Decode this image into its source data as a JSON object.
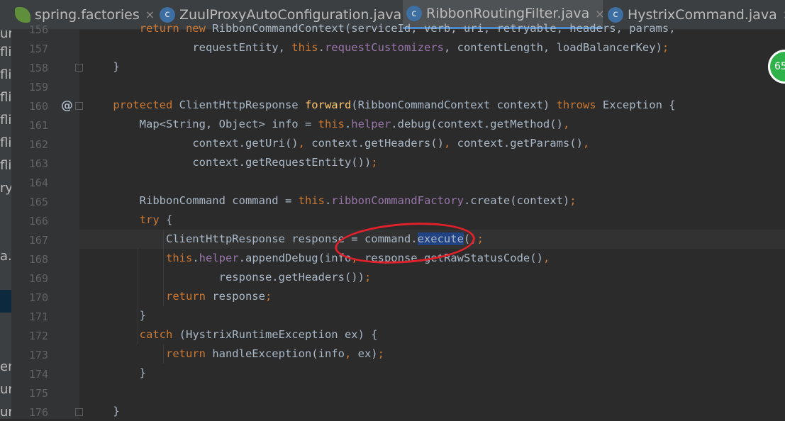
{
  "tabs": [
    {
      "label": "spring.factories",
      "icon": "leaf-icon",
      "active": false
    },
    {
      "label": "ZuulProxyAutoConfiguration.java",
      "icon": "class-icon",
      "active": false
    },
    {
      "label": "RibbonRoutingFilter.java",
      "icon": "class-icon",
      "active": true
    },
    {
      "label": "HystrixCommand.java",
      "icon": "class-icon",
      "active": false
    }
  ],
  "tab_close_glyph": "×",
  "class_icon_letter": "c",
  "sidebar_fragments": [
    "ur",
    "fli",
    "fli",
    "fli",
    "fli",
    "fli",
    "fli",
    "ry",
    "a.j",
    "en",
    "ur",
    "ur"
  ],
  "line_numbers": [
    "156",
    "157",
    "158",
    "159",
    "160",
    "161",
    "162",
    "163",
    "164",
    "165",
    "166",
    "167",
    "168",
    "169",
    "170",
    "171",
    "172",
    "173",
    "174",
    "175",
    "176"
  ],
  "override_marker": "@",
  "code_lines": [
    {
      "indent": "        ",
      "parts": [
        {
          "t": "return new ",
          "c": "kw"
        },
        {
          "t": "RibbonCommandContext(serviceId, verb, uri, retryable, headers, params,"
        }
      ]
    },
    {
      "indent": "                ",
      "parts": [
        {
          "t": "requestEntity, "
        },
        {
          "t": "this",
          "c": "kw"
        },
        {
          "t": "."
        },
        {
          "t": "requestCustomizers",
          "c": "fld"
        },
        {
          "t": ", contentLength, loadBalancerKey)"
        },
        {
          "t": ";",
          "c": "kw"
        }
      ]
    },
    {
      "indent": "    ",
      "parts": [
        {
          "t": "}"
        }
      ]
    },
    {
      "indent": "",
      "parts": []
    },
    {
      "indent": "    ",
      "parts": [
        {
          "t": "protected ",
          "c": "kw"
        },
        {
          "t": "ClientHttpResponse "
        },
        {
          "t": "forward",
          "c": "fn"
        },
        {
          "t": "(RibbonCommandContext context) "
        },
        {
          "t": "throws ",
          "c": "kw"
        },
        {
          "t": "Exception {"
        }
      ]
    },
    {
      "indent": "        ",
      "parts": [
        {
          "t": "Map<String, Object> info = "
        },
        {
          "t": "this",
          "c": "kw"
        },
        {
          "t": "."
        },
        {
          "t": "helper",
          "c": "fld"
        },
        {
          "t": ".debug(context.getMethod()"
        },
        {
          "t": ",",
          "c": "kw"
        }
      ]
    },
    {
      "indent": "                ",
      "parts": [
        {
          "t": "context.getUri()"
        },
        {
          "t": ", ",
          "c": "kw"
        },
        {
          "t": "context.getHeaders()"
        },
        {
          "t": ", ",
          "c": "kw"
        },
        {
          "t": "context.getParams()"
        },
        {
          "t": ",",
          "c": "kw"
        }
      ]
    },
    {
      "indent": "                ",
      "parts": [
        {
          "t": "context.getRequestEntity())"
        },
        {
          "t": ";",
          "c": "kw"
        }
      ]
    },
    {
      "indent": "",
      "parts": []
    },
    {
      "indent": "        ",
      "parts": [
        {
          "t": "RibbonCommand command = "
        },
        {
          "t": "this",
          "c": "kw"
        },
        {
          "t": "."
        },
        {
          "t": "ribbonCommandFactory",
          "c": "fld"
        },
        {
          "t": ".create(context)"
        },
        {
          "t": ";",
          "c": "kw"
        }
      ]
    },
    {
      "indent": "        ",
      "parts": [
        {
          "t": "try ",
          "c": "kw"
        },
        {
          "t": "{"
        }
      ]
    },
    {
      "indent": "            ",
      "parts": [
        {
          "t": "ClientHttpResponse response = command."
        },
        {
          "t": "execute",
          "c": "sel"
        },
        {
          "t": "()"
        },
        {
          "t": ";",
          "c": "kw"
        }
      ]
    },
    {
      "indent": "            ",
      "parts": [
        {
          "t": "this",
          "c": "kw"
        },
        {
          "t": "."
        },
        {
          "t": "helper",
          "c": "fld"
        },
        {
          "t": ".appendDebug(info"
        },
        {
          "t": ", ",
          "c": "kw"
        },
        {
          "t": "response.getRawStatusCode()"
        },
        {
          "t": ",",
          "c": "kw"
        }
      ]
    },
    {
      "indent": "                    ",
      "parts": [
        {
          "t": "response.getHeaders())"
        },
        {
          "t": ";",
          "c": "kw"
        }
      ]
    },
    {
      "indent": "            ",
      "parts": [
        {
          "t": "return ",
          "c": "kw"
        },
        {
          "t": "response"
        },
        {
          "t": ";",
          "c": "kw"
        }
      ]
    },
    {
      "indent": "        ",
      "parts": [
        {
          "t": "}"
        }
      ]
    },
    {
      "indent": "        ",
      "parts": [
        {
          "t": "catch ",
          "c": "kw"
        },
        {
          "t": "(HystrixRuntimeException ex) {"
        }
      ]
    },
    {
      "indent": "            ",
      "parts": [
        {
          "t": "return ",
          "c": "kw"
        },
        {
          "t": "handleException(info"
        },
        {
          "t": ", ",
          "c": "kw"
        },
        {
          "t": "ex)"
        },
        {
          "t": ";",
          "c": "kw"
        }
      ]
    },
    {
      "indent": "        ",
      "parts": [
        {
          "t": "}"
        }
      ]
    },
    {
      "indent": "",
      "parts": []
    },
    {
      "indent": "    ",
      "parts": [
        {
          "t": "}"
        }
      ]
    }
  ],
  "current_line": "167",
  "badge_text": "65",
  "colors": {
    "keyword": "#cc7832",
    "field": "#9876aa",
    "method": "#ffc66d",
    "text": "#a9b7c6",
    "selection": "#214283",
    "annotation_circle": "#e0202a",
    "badge": "#2fb24a"
  }
}
